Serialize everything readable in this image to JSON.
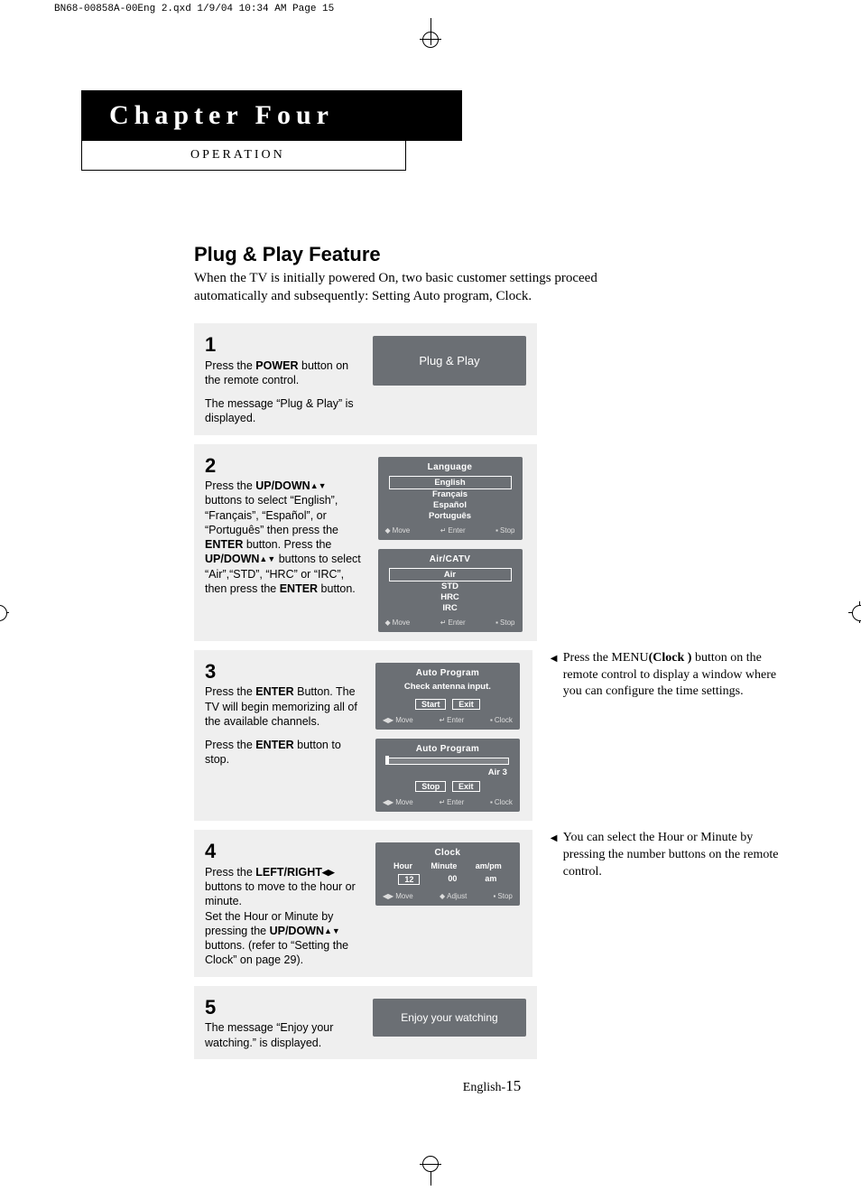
{
  "header_strip": "BN68-00858A-00Eng 2.qxd   1/9/04 10:34 AM   Page 15",
  "chapter_title": "Chapter Four",
  "chapter_subtitle": "OPERATION",
  "feature_title": "Plug & Play Feature",
  "feature_intro": "When the TV is initially powered On, two basic customer settings proceed automatically and subsequently: Setting Auto program, Clock.",
  "steps": {
    "s1": {
      "num": "1",
      "line1": "Press the ",
      "bold1": "POWER",
      "line2": " button on the remote control.",
      "para2": "The message “Plug & Play” is displayed.",
      "osd_big": "Plug & Play"
    },
    "s2": {
      "num": "2",
      "l1": "Press the ",
      "b1": "UP/DOWN",
      "l2": " buttons to select “English”, “Français”, “Español”, or “Português” then press the ",
      "b2": "ENTER",
      "l3": " button. Press the ",
      "b3": "UP/DOWN",
      "l4": " buttons to select “Air”,“STD”, “HRC” or “IRC”, then press the ",
      "b4": "ENTER",
      "l5": " button.",
      "osdA": {
        "title": "Language",
        "selected": "English",
        "items": [
          "Français",
          "Español",
          "Português"
        ],
        "foot": [
          "Move",
          "Enter",
          "Stop"
        ]
      },
      "osdB": {
        "title": "Air/CATV",
        "selected": "Air",
        "items": [
          "STD",
          "HRC",
          "IRC"
        ],
        "foot": [
          "Move",
          "Enter",
          "Stop"
        ]
      }
    },
    "s3": {
      "num": "3",
      "l1": "Press the ",
      "b1": "ENTER",
      "l2": " Button. The TV will begin memorizing all of the available channels.",
      "p2a": "Press the ",
      "p2b": "ENTER",
      "p2c": " button to stop.",
      "osdA": {
        "title": "Auto Program",
        "msg": "Check antenna input.",
        "btns": [
          "Start",
          "Exit"
        ],
        "foot": [
          "Move",
          "Enter",
          "Clock"
        ]
      },
      "osdB": {
        "title": "Auto Program",
        "chan": "Air   3",
        "btns": [
          "Stop",
          "Exit"
        ],
        "foot": [
          "Move",
          "Enter",
          "Clock"
        ]
      },
      "side_note_1a": "Press the MENU",
      "side_note_1b": "(Clock )",
      "side_note_1c": " button on the remote control to display a window where you can configure the time settings."
    },
    "s4": {
      "num": "4",
      "l1": "Press the ",
      "b1": "LEFT/RIGHT",
      "l2": " buttons to move to the hour or minute.\nSet the Hour or Minute by pressing the ",
      "b2": "UP/DOWN",
      "l3": " buttons. (refer to “Setting the Clock” on page 29).",
      "osd": {
        "title": "Clock",
        "cols": [
          "Hour",
          "Minute",
          "am/pm"
        ],
        "vals": [
          "12",
          "00",
          "am"
        ],
        "foot": [
          "Move",
          "Adjust",
          "Stop"
        ]
      },
      "side_note": "You can select the Hour or Minute by pressing the number buttons on the remote control."
    },
    "s5": {
      "num": "5",
      "text": "The message “Enjoy your watching.” is displayed.",
      "osd_big": "Enjoy your watching"
    }
  },
  "page_footer_lang": "English-",
  "page_footer_num": "15"
}
